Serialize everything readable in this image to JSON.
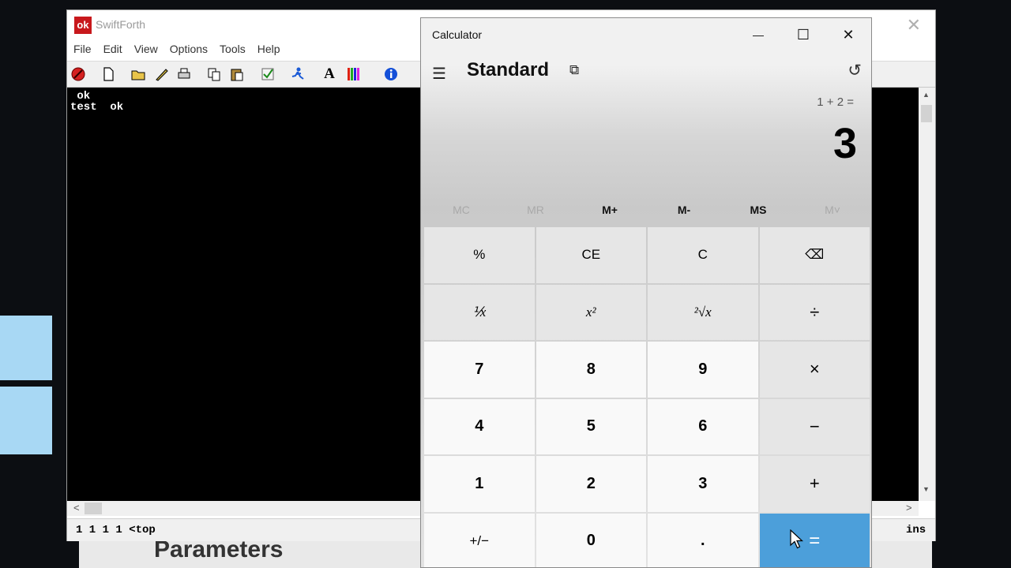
{
  "swiftforth": {
    "title": "SwiftForth",
    "logo_text": "ok",
    "close": "✕",
    "menu": [
      "File",
      "Edit",
      "View",
      "Options",
      "Tools",
      "Help"
    ],
    "console_lines": [
      " ok",
      "test  ok"
    ],
    "status_left": "1 1 1 1 <top",
    "status_right": "ins",
    "scroll_up": "▲",
    "scroll_down": "▼",
    "scroll_left": "<",
    "scroll_right": ">"
  },
  "background_window": {
    "text": "Parameters"
  },
  "calculator": {
    "title": "Calculator",
    "minimize": "—",
    "maximize": "☐",
    "close": "✕",
    "menu_icon": "☰",
    "mode": "Standard",
    "keep_on_top_icon": "⧉",
    "history_icon": "↺",
    "expression": "1 + 2 =",
    "result": "3",
    "memory": [
      {
        "label": "MC",
        "enabled": false
      },
      {
        "label": "MR",
        "enabled": false
      },
      {
        "label": "M+",
        "enabled": true
      },
      {
        "label": "M-",
        "enabled": true
      },
      {
        "label": "MS",
        "enabled": true
      },
      {
        "label": "M˅",
        "enabled": false
      }
    ],
    "keys": {
      "percent": "%",
      "ce": "CE",
      "c": "C",
      "backspace": "⌫",
      "reciprocal": "⅟x",
      "square": "x²",
      "sqrt": "²√x",
      "divide": "÷",
      "seven": "7",
      "eight": "8",
      "nine": "9",
      "multiply": "×",
      "four": "4",
      "five": "5",
      "six": "6",
      "minus": "−",
      "one": "1",
      "two": "2",
      "three": "3",
      "plus": "+",
      "negate": "+/−",
      "zero": "0",
      "decimal": ".",
      "equals": "="
    }
  },
  "colors": {
    "equals_accent": "#4c9fda",
    "swiftforth_logo": "#c8181c",
    "console_bg": "#000000"
  }
}
